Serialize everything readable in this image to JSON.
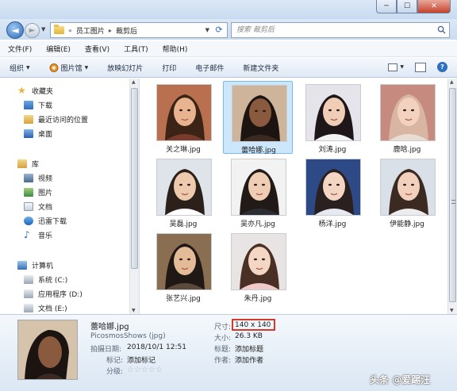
{
  "window": {
    "minimize": "─",
    "maximize": "☐",
    "close": "✕"
  },
  "address": {
    "prefix": "«",
    "crumbs": [
      "员工图片",
      "裁剪后"
    ],
    "separator": "▸"
  },
  "search": {
    "placeholder": "搜索 裁剪后"
  },
  "menu": [
    "文件(F)",
    "编辑(E)",
    "查看(V)",
    "工具(T)",
    "帮助(H)"
  ],
  "toolbar": {
    "organize": "组织",
    "picture_viewer": "图片馆",
    "slideshow": "放映幻灯片",
    "print": "打印",
    "email": "电子邮件",
    "new_folder": "新建文件夹"
  },
  "nav": {
    "favorites": "收藏夹",
    "downloads": "下载",
    "recent": "最近访问的位置",
    "desktop": "桌面",
    "libraries": "库",
    "videos": "视频",
    "pictures": "图片",
    "documents": "文档",
    "xunlei": "迅雷下载",
    "music": "音乐",
    "computer": "计算机",
    "drive_c": "系统 (C:)",
    "drive_d": "应用程序 (D:)",
    "drive_e": "文档 (E:)"
  },
  "files": [
    {
      "name": "关之琳.jpg",
      "bg": "#b9704e",
      "skin": "#e8b48f",
      "hair": "#3b2416",
      "shirt": "#7a3b2b"
    },
    {
      "name": "蕾哈娜.jpg",
      "bg": "#cdb49a",
      "skin": "#8a5a3e",
      "hair": "#1c1410",
      "shirt": "#3a2a22",
      "selected": true
    },
    {
      "name": "刘涛.jpg",
      "bg": "#e4e4ea",
      "skin": "#f0cdb6",
      "hair": "#1e1618",
      "shirt": "#f3f3f3"
    },
    {
      "name": "鹿晗.jpg",
      "bg": "#c78a7f",
      "skin": "#f2d2bf",
      "hair": "#d9b5a4",
      "shirt": "#e9dcd2"
    },
    {
      "name": "吴磊.jpg",
      "bg": "#dfe4ea",
      "skin": "#edc9ad",
      "hair": "#2b201a",
      "shirt": "#ffffff"
    },
    {
      "name": "吴亦凡.jpg",
      "bg": "#f2f2f2",
      "skin": "#efcdb4",
      "hair": "#221a16",
      "shirt": "#2d2d34"
    },
    {
      "name": "杨洋.jpg",
      "bg": "#2d4a86",
      "skin": "#f3d5c3",
      "hair": "#2a2020",
      "shirt": "#e6e9f0"
    },
    {
      "name": "伊能静.jpg",
      "bg": "#d9e0e8",
      "skin": "#f1d0bc",
      "hair": "#3b2a22",
      "shirt": "#ececec"
    },
    {
      "name": "张艺兴.jpg",
      "bg": "#8a6e52",
      "skin": "#e3bb97",
      "hair": "#1f1814",
      "shirt": "#5a4a3c"
    },
    {
      "name": "朱丹.jpg",
      "bg": "#e8e4e3",
      "skin": "#f4d6c5",
      "hair": "#4a3024",
      "shirt": "#f2c9c9"
    }
  ],
  "details": {
    "filename": "蕾哈娜.jpg",
    "type": "PicosmosShows (jpg)",
    "date_label": "拍摄日期:",
    "date_value": "2018/10/1 12:51",
    "tags_label": "标记:",
    "tags_value": "添加标记",
    "rating_label": "分级:",
    "dim_label": "尺寸:",
    "dim_value": "140 x 140",
    "size_label": "大小:",
    "size_value": "26.3 KB",
    "title_label": "标题:",
    "title_value": "添加标题",
    "author_label": "作者:",
    "author_value": "添加作者",
    "stars": "☆☆☆☆☆"
  },
  "watermark": "头条 @爱踢汪"
}
